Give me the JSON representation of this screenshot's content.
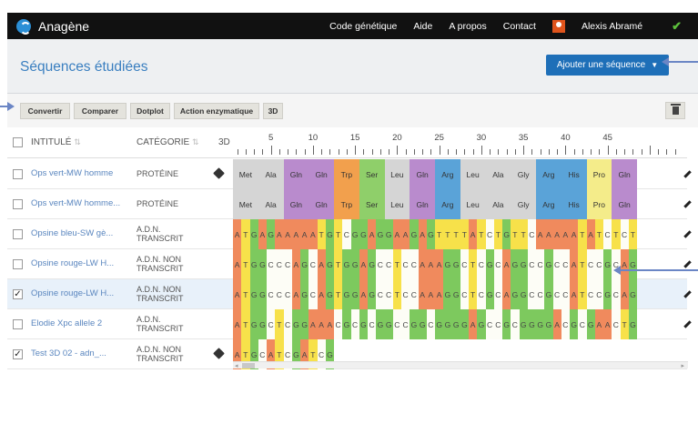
{
  "navbar": {
    "brand": "Anagène",
    "links": [
      "Code génétique",
      "Aide",
      "A propos",
      "Contact"
    ],
    "user_name": "Alexis Abramé"
  },
  "header": {
    "title": "Séquences étudiées",
    "add_button": "Ajouter une séquence"
  },
  "toolbar": {
    "buttons": [
      "Convertir",
      "Comparer",
      "Dotplot",
      "Action enzymatique",
      "3D"
    ]
  },
  "table": {
    "headers": {
      "name": "INTITULÉ",
      "category": "CATÉGORIE",
      "three_d": "3D"
    },
    "ruler_numbers": [
      "5",
      "10",
      "15",
      "20",
      "25",
      "30",
      "35",
      "40",
      "45"
    ],
    "rows": [
      {
        "name": "Ops vert-MW homme",
        "category_line1": "PROTÉINE",
        "category_line2": "",
        "checked": false,
        "has_3d": true,
        "type": "protein",
        "sequence": [
          "Met",
          "Ala",
          "Gln",
          "Gln",
          "Trp",
          "Ser",
          "Leu",
          "Gln",
          "Arg",
          "Leu",
          "Ala",
          "Gly",
          "Arg",
          "His",
          "Pro",
          "Gln"
        ]
      },
      {
        "name": "Ops vert-MW homme...",
        "category_line1": "PROTÉINE",
        "category_line2": "",
        "checked": false,
        "has_3d": false,
        "type": "protein",
        "sequence": [
          "Met",
          "Ala",
          "Gln",
          "Gln",
          "Trp",
          "Ser",
          "Leu",
          "Gln",
          "Arg",
          "Leu",
          "Ala",
          "Gly",
          "Arg",
          "His",
          "Pro",
          "Gln"
        ]
      },
      {
        "name": "Opsine bleu-SW gè...",
        "category_line1": "A.D.N.",
        "category_line2": "TRANSCRIT",
        "checked": false,
        "has_3d": false,
        "type": "dna",
        "sequence": "ATGAGAAAAATGTCGGAGGAAGAGTTTTATCTGTTCAAAAATATCTCT"
      },
      {
        "name": "Opsine rouge-LW H...",
        "category_line1": "A.D.N. NON",
        "category_line2": "TRANSCRIT",
        "checked": false,
        "has_3d": false,
        "type": "dna",
        "sequence": "ATGGCCCAGCAGTGGAGCCTCCAAAGGCTCGCAGGCCGCCATCCGCAG"
      },
      {
        "name": "Opsine rouge-LW H...",
        "category_line1": "A.D.N. NON",
        "category_line2": "TRANSCRIT",
        "checked": true,
        "has_3d": false,
        "type": "dna",
        "sequence": "ATGGCCCAGCAGTGGAGCCTCCAAAGGCTCGCAGGCCGCCATCCGCAG"
      },
      {
        "name": "Elodie Xpc allele 2",
        "category_line1": "A.D.N.",
        "category_line2": "TRANSCRIT",
        "checked": false,
        "has_3d": false,
        "type": "dna",
        "sequence": "ATGGCTCGGAAACGCGCGGCCGGCGGGGAGCCGCGGGGACGCGAACTG"
      },
      {
        "name": "Test 3D 02 - adn_...",
        "category_line1": "A.D.N. NON",
        "category_line2": "TRANSCRIT",
        "checked": true,
        "has_3d": true,
        "type": "dna",
        "sequence": "ATGCATCGATCG"
      }
    ]
  },
  "colors": {
    "A": "#f08a5d",
    "T": "#f7e14a",
    "G": "#7dc95e",
    "C": "#fdfdf6",
    "Met": "#d5d5d5",
    "Ala": "#d5d5d5",
    "Gln": "#b98bcd",
    "Trp": "#f2a04d",
    "Ser": "#8fcf6a",
    "Leu": "#d5d5d5",
    "Arg": "#5aa3d8",
    "Gly": "#d5d5d5",
    "His": "#5aa3d8",
    "Pro": "#f4ec8a"
  }
}
